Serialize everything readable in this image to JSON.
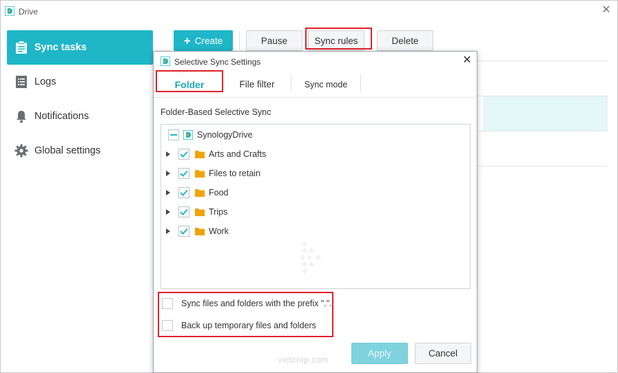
{
  "app": {
    "title": "Drive"
  },
  "sidebar": {
    "items": [
      {
        "label": "Sync tasks",
        "icon": "clipboard-icon",
        "active": true
      },
      {
        "label": "Logs",
        "icon": "document-list-icon",
        "active": false
      },
      {
        "label": "Notifications",
        "icon": "bell-icon",
        "active": false
      },
      {
        "label": "Global settings",
        "icon": "gear-icon",
        "active": false
      }
    ]
  },
  "toolbar": {
    "create_label": "Create",
    "pause_label": "Pause",
    "sync_rules_label": "Sync rules",
    "delete_label": "Delete"
  },
  "dialog": {
    "title": "Selective Sync Settings",
    "tabs": [
      {
        "label": "Folder",
        "active": true
      },
      {
        "label": "File filter",
        "active": false
      },
      {
        "label": "Sync mode",
        "active": false
      }
    ],
    "section_label": "Folder-Based Selective Sync",
    "tree": {
      "root": {
        "label": "SynologyDrive",
        "state": "partial"
      },
      "children": [
        {
          "label": "Arts and Crafts",
          "checked": true
        },
        {
          "label": "Files to retain",
          "checked": true
        },
        {
          "label": "Food",
          "checked": true
        },
        {
          "label": "Trips",
          "checked": true
        },
        {
          "label": "Work",
          "checked": true
        }
      ]
    },
    "options": [
      {
        "label": "Sync files and folders with the prefix \".\".",
        "checked": false
      },
      {
        "label": "Back up temporary files and folders",
        "checked": false
      }
    ],
    "apply_label": "Apply",
    "cancel_label": "Cancel"
  },
  "watermark": "vietcorp.com",
  "colors": {
    "accent": "#1fb6c8",
    "highlight": "#e0202a",
    "folder": "#f0a30a"
  }
}
